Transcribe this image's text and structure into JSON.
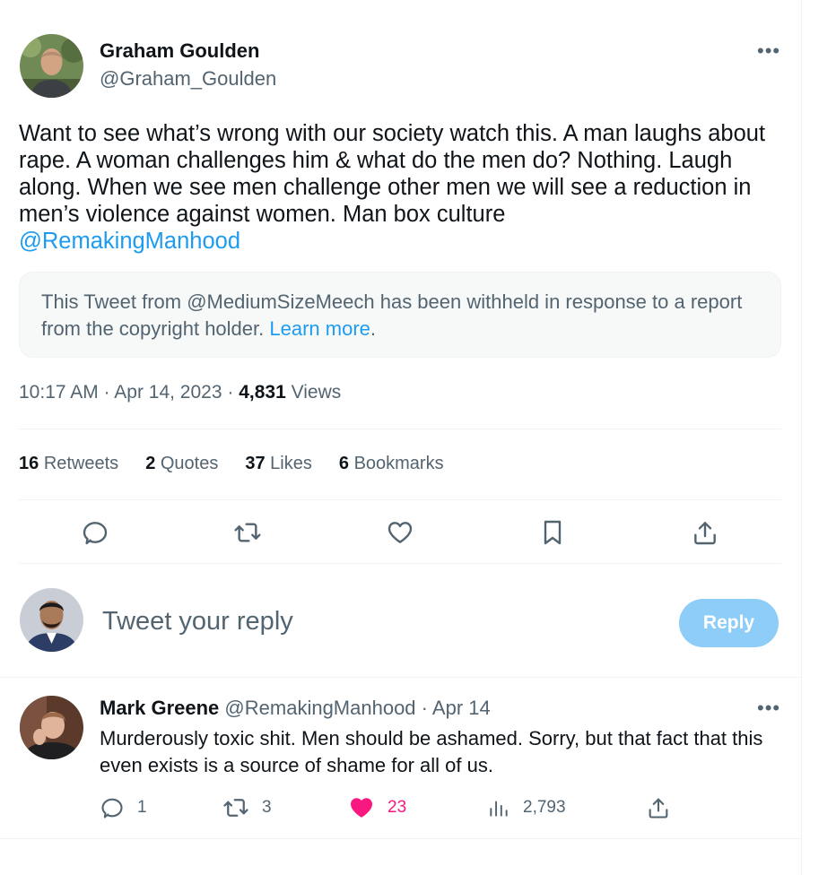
{
  "tweet": {
    "author_name": "Graham Goulden",
    "author_handle": "@Graham_Goulden",
    "more_label": "•••",
    "text_main": "Want to see what’s wrong with our society watch this. A man laughs about rape. A woman challenges him & what do the men do?  Nothing. Laugh along. When we see men challenge other men we will see a reduction in men’s violence against women. Man box culture",
    "text_mention": "@RemakingManhood",
    "withheld_text": "This Tweet from @MediumSizeMeech has been withheld in response to a report from the copyright holder.",
    "withheld_link": "Learn more",
    "withheld_end": ".",
    "time": "10:17 AM",
    "date": "Apr 14, 2023",
    "sep": "·",
    "views_count": "4,831",
    "views_label": "Views"
  },
  "stats": [
    {
      "count": "16",
      "label": "Retweets"
    },
    {
      "count": "2",
      "label": "Quotes"
    },
    {
      "count": "37",
      "label": "Likes"
    },
    {
      "count": "6",
      "label": "Bookmarks"
    }
  ],
  "actions": [
    "reply-icon",
    "retweet-icon",
    "like-icon",
    "bookmark-icon",
    "share-icon"
  ],
  "composer": {
    "placeholder": "Tweet your reply",
    "button_label": "Reply"
  },
  "reply": {
    "name": "Mark Greene",
    "handle": "@RemakingManhood",
    "date": "Apr 14",
    "sep": "·",
    "more_label": "•••",
    "text": "Murderously toxic shit. Men should be ashamed. Sorry, but that fact that this even exists is a source of shame for all of us.",
    "replies": "1",
    "retweets": "3",
    "likes": "23",
    "views": "2,793"
  },
  "colors": {
    "accent": "#1d9bf0",
    "like": "#f91880",
    "muted": "#536471",
    "reply_button": "#8ecdf8"
  }
}
